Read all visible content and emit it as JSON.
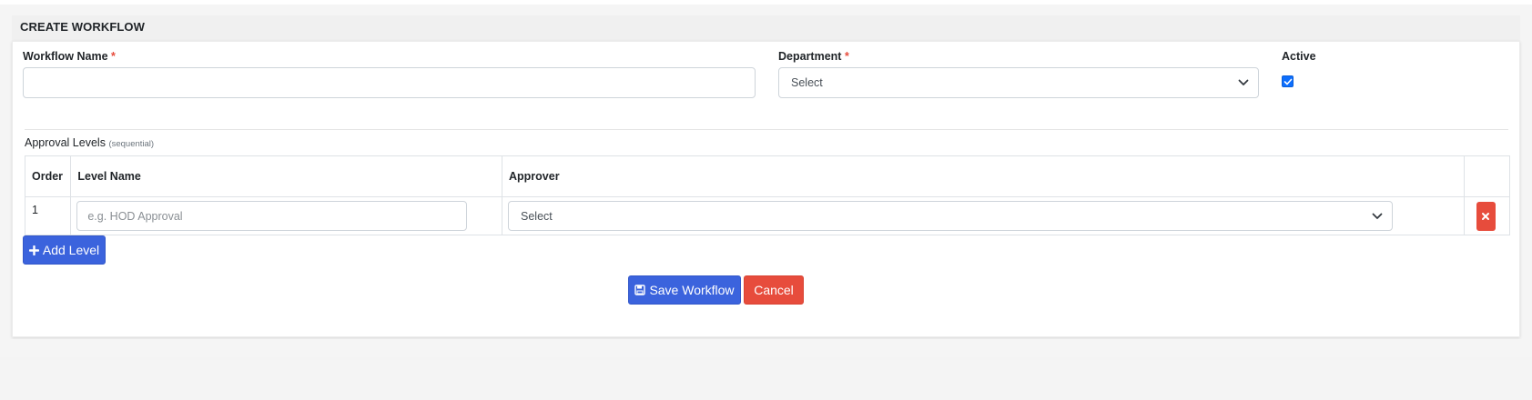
{
  "page": {
    "title": "CREATE WORKFLOW"
  },
  "form": {
    "workflow_name": {
      "label": "Workflow Name",
      "required_mark": "*",
      "value": "",
      "placeholder": ""
    },
    "department": {
      "label": "Department",
      "required_mark": "*",
      "selected": "Select"
    },
    "active": {
      "label": "Active",
      "checked": true
    }
  },
  "approval_levels": {
    "title": "Approval Levels",
    "hint": "(sequential)",
    "columns": [
      "Order",
      "Level Name",
      "Approver",
      ""
    ],
    "rows": [
      {
        "order": "1",
        "level_name_placeholder": "e.g. HOD Approval",
        "approver_selected": "Select"
      }
    ],
    "add_button": "Add Level"
  },
  "actions": {
    "save": "Save Workflow",
    "cancel": "Cancel"
  },
  "colors": {
    "primary": "#3b63dd",
    "danger": "#e74c3c",
    "required": "#e74c3c",
    "checkbox": "#0d6efd"
  },
  "icons": [
    "chevron-down-icon",
    "check-icon",
    "close-icon",
    "plus-icon",
    "save-icon"
  ]
}
